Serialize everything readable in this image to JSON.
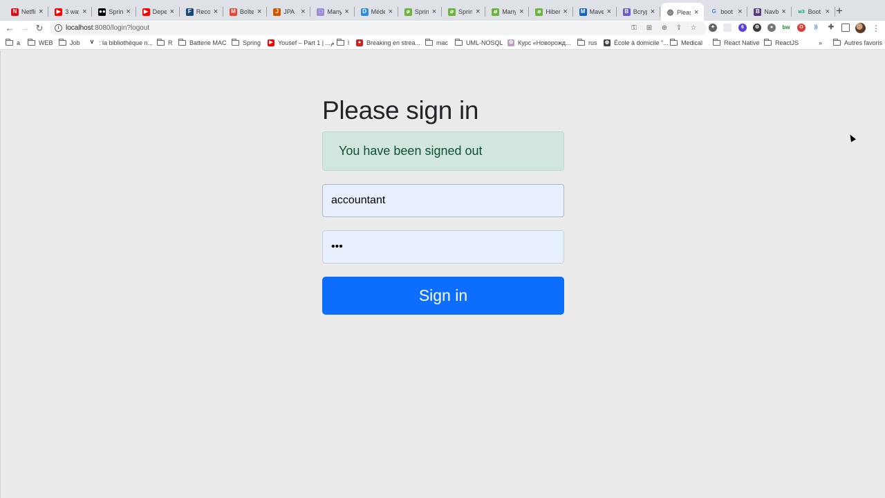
{
  "browser": {
    "tabs": [
      {
        "title": "Netfli",
        "icon": "netflix-icon",
        "color": "#e50914",
        "glyph": "N"
      },
      {
        "title": "3 way",
        "icon": "youtube-icon",
        "color": "#ff0000",
        "glyph": "▶"
      },
      {
        "title": "Sprin",
        "icon": "medium-icon",
        "color": "#000000",
        "glyph": "●●"
      },
      {
        "title": "Depe",
        "icon": "youtube-icon",
        "color": "#ff0000",
        "glyph": "▶"
      },
      {
        "title": "Reco",
        "icon": "fa-icon",
        "color": "#1a4a7a",
        "glyph": "F"
      },
      {
        "title": "Boîte",
        "icon": "gmail-icon",
        "color": "#ea4335",
        "glyph": "M"
      },
      {
        "title": "JPA",
        "icon": "jpa-icon",
        "color": "#d35400",
        "glyph": "J"
      },
      {
        "title": "Many",
        "icon": "page-icon",
        "color": "#9b8ad6",
        "glyph": "□"
      },
      {
        "title": "Méde",
        "icon": "d-icon",
        "color": "#2f8be0",
        "glyph": "D"
      },
      {
        "title": "Sprin",
        "icon": "spring-icon",
        "color": "#6db33f",
        "glyph": "⌀"
      },
      {
        "title": "Sprin",
        "icon": "spring-icon",
        "color": "#6db33f",
        "glyph": "⌀"
      },
      {
        "title": "Many",
        "icon": "spring-icon",
        "color": "#6db33f",
        "glyph": "⌀"
      },
      {
        "title": "Hiber",
        "icon": "spring-icon",
        "color": "#6db33f",
        "glyph": "⌀"
      },
      {
        "title": "Mave",
        "icon": "maven-icon",
        "color": "#1565c0",
        "glyph": "M"
      },
      {
        "title": "Bcryp",
        "icon": "bcrypt-icon",
        "color": "#6a5acd",
        "glyph": "B"
      },
      {
        "title": "Pleas",
        "icon": "globe-icon",
        "color": "#5f6368",
        "glyph": "◍",
        "active": true
      },
      {
        "title": "boot",
        "icon": "google-icon",
        "color": "#4285f4",
        "glyph": "G"
      },
      {
        "title": "Navb",
        "icon": "bootstrap-icon",
        "color": "#563d7c",
        "glyph": "B"
      },
      {
        "title": "Boot",
        "icon": "w3schools-icon",
        "color": "#04aa6d",
        "glyph": "w3"
      }
    ],
    "url_host": "localhost",
    "url_path": ":8080/login?logout",
    "bookmarks": [
      {
        "label": "a",
        "type": "folder"
      },
      {
        "label": "WEB",
        "type": "folder"
      },
      {
        "label": "Job",
        "type": "folder"
      },
      {
        "label": ": la bibliothèque n...",
        "type": "site",
        "glyph": "V",
        "color": "#ffffff"
      },
      {
        "label": "R",
        "type": "folder"
      },
      {
        "label": "Batterie MAC",
        "type": "folder"
      },
      {
        "label": "Spring",
        "type": "folder"
      },
      {
        "label": "Yousef – Part 1 | ...م",
        "type": "site",
        "glyph": "▶",
        "color": "#ff0000"
      },
      {
        "label": "l",
        "type": "folder"
      },
      {
        "label": "Breaking en strea...",
        "type": "site",
        "glyph": "●",
        "color": "#cc2222"
      },
      {
        "label": "mac",
        "type": "folder"
      },
      {
        "label": "UML-NOSQL",
        "type": "folder"
      },
      {
        "label": "Курс «Новорожд...",
        "type": "site",
        "glyph": "✿",
        "color": "#c0a0c0"
      },
      {
        "label": "rus",
        "type": "folder"
      },
      {
        "label": "École à domicile \"...",
        "type": "site",
        "glyph": "◍",
        "color": "#444444"
      },
      {
        "label": "Medical",
        "type": "folder"
      },
      {
        "label": "React Native",
        "type": "folder"
      },
      {
        "label": "ReactJS",
        "type": "folder"
      }
    ],
    "more_bookmarks": "»",
    "other_bookmarks": "Autres favoris"
  },
  "login": {
    "heading": "Please sign in",
    "alert": "You have been signed out",
    "username_value": "accountant",
    "password_value": "•••",
    "submit_label": "Sign in"
  }
}
